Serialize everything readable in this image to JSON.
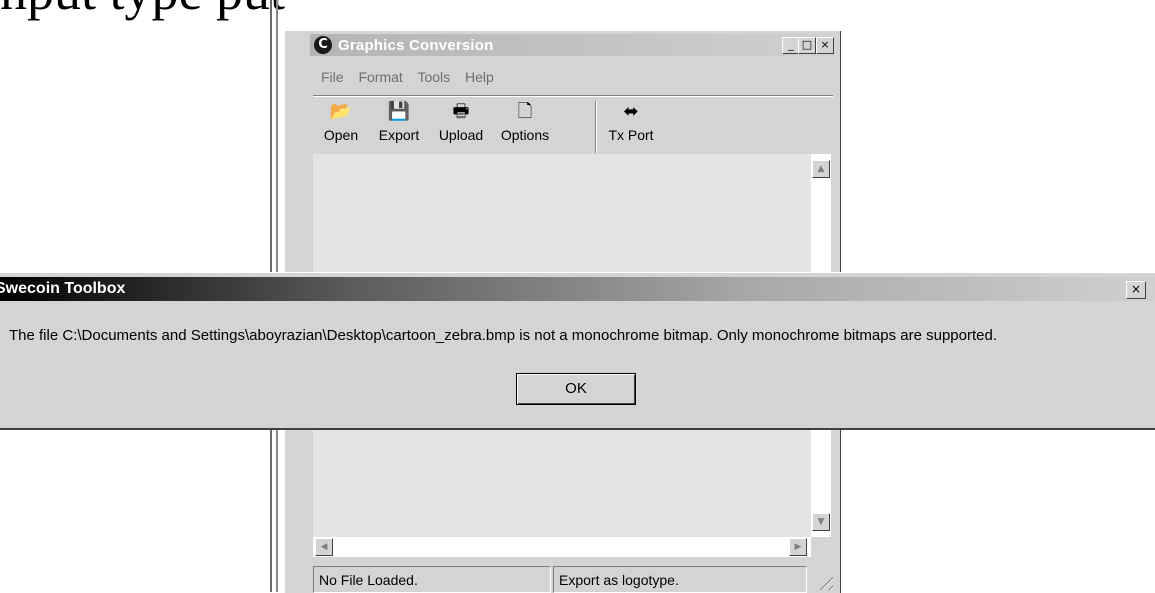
{
  "background": {
    "partial_text": "nput type                                          put"
  },
  "window": {
    "title": "Graphics Conversion",
    "app_icon_glyph": "C",
    "controls": {
      "minimize": "_",
      "maximize": "□",
      "close": "×"
    },
    "menu": [
      "File",
      "Format",
      "Tools",
      "Help"
    ],
    "toolbar": [
      {
        "label": "Open",
        "icon": "open-folder-icon",
        "glyph": "📂"
      },
      {
        "label": "Export",
        "icon": "floppy-disk-icon",
        "glyph": "💾"
      },
      {
        "label": "Upload",
        "icon": "printer-icon",
        "glyph": "🖶"
      },
      {
        "label": "Options",
        "icon": "document-icon",
        "glyph": "🗋"
      },
      {
        "label": "Tx Port",
        "icon": "port-connector-icon",
        "glyph": "⬌"
      }
    ],
    "scroll": {
      "up": "▲",
      "down": "▼",
      "left": "◀",
      "right": "▶"
    },
    "status": {
      "left": "No File Loaded.",
      "right": "Export as logotype."
    }
  },
  "dialog": {
    "title": "Swecoin Toolbox",
    "close_glyph": "×",
    "message": "The file C:\\Documents and Settings\\aboyrazian\\Desktop\\cartoon_zebra.bmp is not a monochrome bitmap. Only monochrome bitmaps are supported.",
    "ok_label": "OK"
  }
}
